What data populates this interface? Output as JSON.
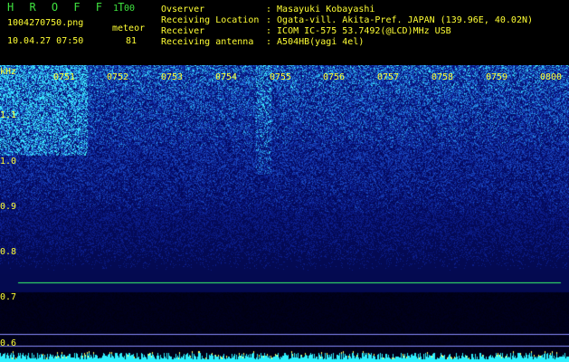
{
  "app": {
    "title": "H R O F F T",
    "version": "1.00",
    "filename": "1004270750.png",
    "datetime": "10.04.27 07:50",
    "meteor_label": "meteor",
    "meteor_count": "81"
  },
  "info": [
    {
      "label": "Ovserver",
      "value": ": Masayuki Kobayashi"
    },
    {
      "label": "Receiving Location",
      "value": ": Ogata-vill. Akita-Pref. JAPAN (139.96E, 40.02N)"
    },
    {
      "label": "Receiver",
      "value": ": ICOM IC-575 53.7492(@LCD)MHz USB"
    },
    {
      "label": "Receiving antenna",
      "value": ": A504HB(yagi 4el)"
    }
  ],
  "axis": {
    "yunit": "kHz",
    "yticks": [
      "1.1",
      "1.0",
      "0.9",
      "0.8",
      "0.7",
      "0.6"
    ],
    "xticks": [
      "0751",
      "0752",
      "0753",
      "0754",
      "0755",
      "0756",
      "0757",
      "0758",
      "0759",
      "0800"
    ]
  },
  "colors": {
    "header_green": "#3fe23f",
    "header_yellow": "#ffff33",
    "background_blue": "#0a1a7a",
    "line_green": "#39ff6a",
    "line_lavender": "#8a8cff",
    "noise_cyan": "#2ff0ff"
  }
}
